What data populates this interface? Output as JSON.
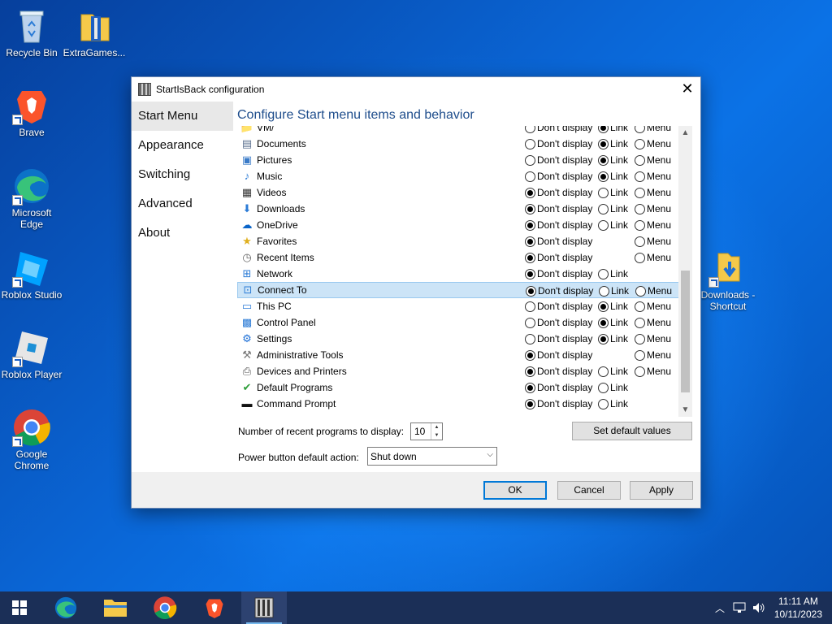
{
  "desktop": {
    "icons": [
      {
        "label": "Recycle Bin"
      },
      {
        "label": "ExtraGames..."
      },
      {
        "label": "Brave"
      },
      {
        "label": "Microsoft Edge"
      },
      {
        "label": "Roblox Studio"
      },
      {
        "label": "Roblox Player"
      },
      {
        "label": "Google Chrome"
      },
      {
        "label": "Downloads - Shortcut"
      }
    ]
  },
  "dialog": {
    "title": "StartIsBack configuration",
    "close_glyph": "✕",
    "nav": [
      {
        "label": "Start Menu",
        "active": true
      },
      {
        "label": "Appearance"
      },
      {
        "label": "Switching"
      },
      {
        "label": "Advanced"
      },
      {
        "label": "About"
      }
    ],
    "heading": "Configure Start menu items and behavior",
    "option_labels": {
      "dont": "Don't display",
      "link": "Link",
      "menu": "Menu"
    },
    "items": [
      {
        "name": "VM/",
        "icon": "folder-icon",
        "opts": [
          "dont",
          "link",
          "menu"
        ],
        "selected": "link"
      },
      {
        "name": "Documents",
        "icon": "documents-icon",
        "opts": [
          "dont",
          "link",
          "menu"
        ],
        "selected": "link"
      },
      {
        "name": "Pictures",
        "icon": "pictures-icon",
        "opts": [
          "dont",
          "link",
          "menu"
        ],
        "selected": "link"
      },
      {
        "name": "Music",
        "icon": "music-icon",
        "opts": [
          "dont",
          "link",
          "menu"
        ],
        "selected": "link"
      },
      {
        "name": "Videos",
        "icon": "videos-icon",
        "opts": [
          "dont",
          "link",
          "menu"
        ],
        "selected": "dont"
      },
      {
        "name": "Downloads",
        "icon": "downloads-icon",
        "opts": [
          "dont",
          "link",
          "menu"
        ],
        "selected": "dont"
      },
      {
        "name": "OneDrive",
        "icon": "onedrive-icon",
        "opts": [
          "dont",
          "link",
          "menu"
        ],
        "selected": "dont"
      },
      {
        "name": "Favorites",
        "icon": "favorites-icon",
        "opts": [
          "dont",
          "menu"
        ],
        "selected": "dont"
      },
      {
        "name": "Recent Items",
        "icon": "recent-items-icon",
        "opts": [
          "dont",
          "menu"
        ],
        "selected": "dont"
      },
      {
        "name": "Network",
        "icon": "network-icon",
        "opts": [
          "dont",
          "link"
        ],
        "selected": "dont"
      },
      {
        "name": "Connect To",
        "icon": "connect-to-icon",
        "opts": [
          "dont",
          "link",
          "menu"
        ],
        "selected": "dont",
        "highlighted": true
      },
      {
        "name": "This PC",
        "icon": "this-pc-icon",
        "opts": [
          "dont",
          "link",
          "menu"
        ],
        "selected": "link"
      },
      {
        "name": "Control Panel",
        "icon": "control-panel-icon",
        "opts": [
          "dont",
          "link",
          "menu"
        ],
        "selected": "link"
      },
      {
        "name": "Settings",
        "icon": "settings-icon",
        "opts": [
          "dont",
          "link",
          "menu"
        ],
        "selected": "link"
      },
      {
        "name": "Administrative Tools",
        "icon": "admin-tools-icon",
        "opts": [
          "dont",
          "menu"
        ],
        "selected": "dont"
      },
      {
        "name": "Devices and Printers",
        "icon": "printer-icon",
        "opts": [
          "dont",
          "link",
          "menu"
        ],
        "selected": "dont"
      },
      {
        "name": "Default Programs",
        "icon": "default-programs-icon",
        "opts": [
          "dont",
          "link"
        ],
        "selected": "dont"
      },
      {
        "name": "Command Prompt",
        "icon": "command-prompt-icon",
        "opts": [
          "dont",
          "link"
        ],
        "selected": "dont"
      }
    ],
    "recent_label": "Number of recent programs to display:",
    "recent_value": "10",
    "set_default_label": "Set default values",
    "power_label": "Power button default action:",
    "power_value": "Shut down",
    "ok_label": "OK",
    "cancel_label": "Cancel",
    "apply_label": "Apply"
  },
  "taskbar": {
    "items": [
      "start-button",
      "edge",
      "file-explorer",
      "chrome",
      "brave",
      "startisback-config"
    ],
    "clock_time": "11:11 AM",
    "clock_date": "10/11/2023"
  }
}
